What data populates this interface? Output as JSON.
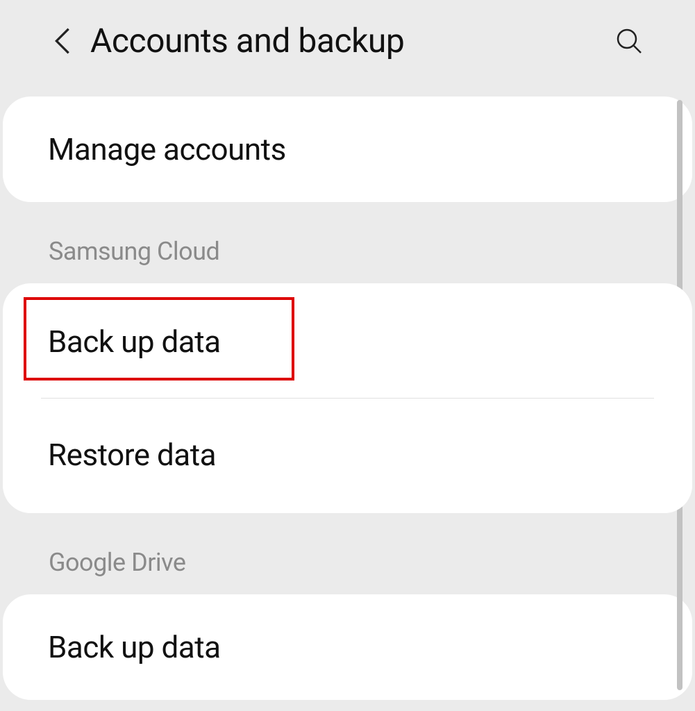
{
  "header": {
    "title": "Accounts and backup"
  },
  "sections": {
    "top": {
      "items": [
        {
          "label": "Manage accounts"
        }
      ]
    },
    "samsung_cloud": {
      "title": "Samsung Cloud",
      "items": [
        {
          "label": "Back up data"
        },
        {
          "label": "Restore data"
        }
      ]
    },
    "google_drive": {
      "title": "Google Drive",
      "items": [
        {
          "label": "Back up data"
        }
      ]
    }
  }
}
